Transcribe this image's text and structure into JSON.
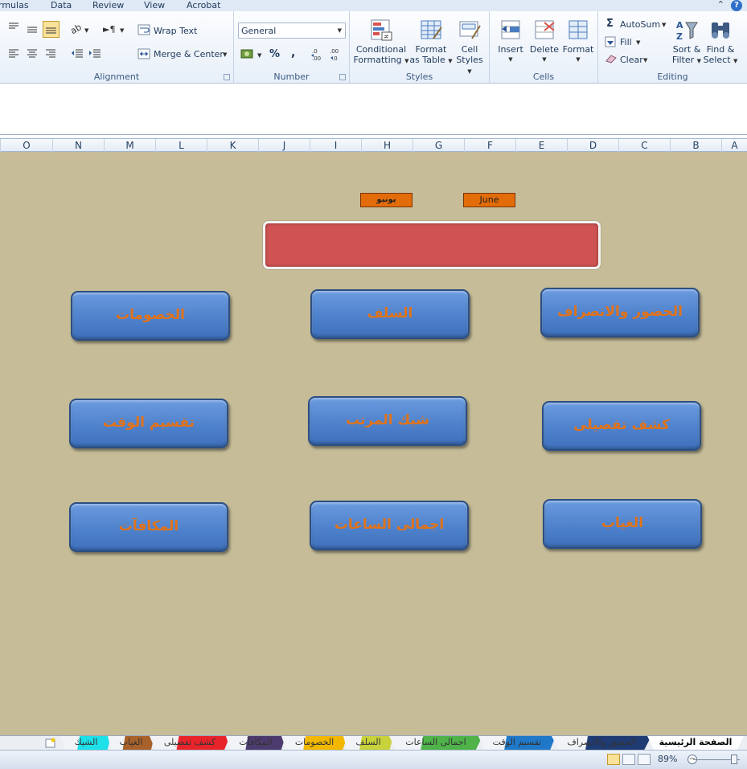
{
  "ribbon_tabs": [
    "rmulas",
    "Data",
    "Review",
    "View",
    "Acrobat"
  ],
  "groups": {
    "alignment": {
      "label": "Alignment",
      "wrap_text": "Wrap Text",
      "merge_center": "Merge & Center"
    },
    "number": {
      "label": "Number",
      "format_value": "General",
      "percent": "%",
      "comma": ",",
      "inc_decimal": ".0 .00",
      "dec_decimal": ".00 .0"
    },
    "styles": {
      "label": "Styles",
      "conditional_formatting": [
        "Conditional",
        "Formatting"
      ],
      "format_as_table": [
        "Format",
        "as Table"
      ],
      "cell_styles": [
        "Cell",
        "Styles"
      ]
    },
    "cells": {
      "label": "Cells",
      "insert": "Insert",
      "delete": "Delete",
      "format": "Format"
    },
    "editing": {
      "label": "Editing",
      "autosum": "AutoSum",
      "fill": "Fill",
      "clear": "Clear",
      "sort_filter": [
        "Sort &",
        "Filter"
      ],
      "find_select": [
        "Find &",
        "Select"
      ]
    }
  },
  "column_headers": [
    "O",
    "N",
    "M",
    "L",
    "K",
    "J",
    "I",
    "H",
    "G",
    "F",
    "E",
    "D",
    "C",
    "B",
    "A"
  ],
  "sheet": {
    "month_arabic": "يونيو",
    "month_english": "June",
    "buttons": {
      "attendance": "الحضور والانصراف",
      "advances": "السلف",
      "deductions": "الخصومات",
      "detailed_report": "كشف تفصيلى",
      "payroll": "شيك المرتب",
      "time_division": "تقسيم الوقت",
      "absence": "الغياب",
      "total_hours": "اجمالى الساعات",
      "bonuses": "المكافآت"
    }
  },
  "sheet_tabs": [
    {
      "label": "الصفحة الرئيسية",
      "color": "#ffffff",
      "active": true
    },
    {
      "label": "الحضور والانصراف",
      "color": "#1f3b73"
    },
    {
      "label": "تقسيم الوقت",
      "color": "#1f78c8"
    },
    {
      "label": "اجمالى الساعات",
      "color": "#4fb34a"
    },
    {
      "label": "السلف",
      "color": "#c8d23a"
    },
    {
      "label": "الخصومات",
      "color": "#f2b800"
    },
    {
      "label": "المكافآت",
      "color": "#4c3b6e"
    },
    {
      "label": "كشف تفصيلى",
      "color": "#e8242b"
    },
    {
      "label": "الغياب",
      "color": "#a8612a"
    },
    {
      "label": "الشيك",
      "color": "#1ee0e8"
    }
  ],
  "status": {
    "zoom": "89%"
  }
}
